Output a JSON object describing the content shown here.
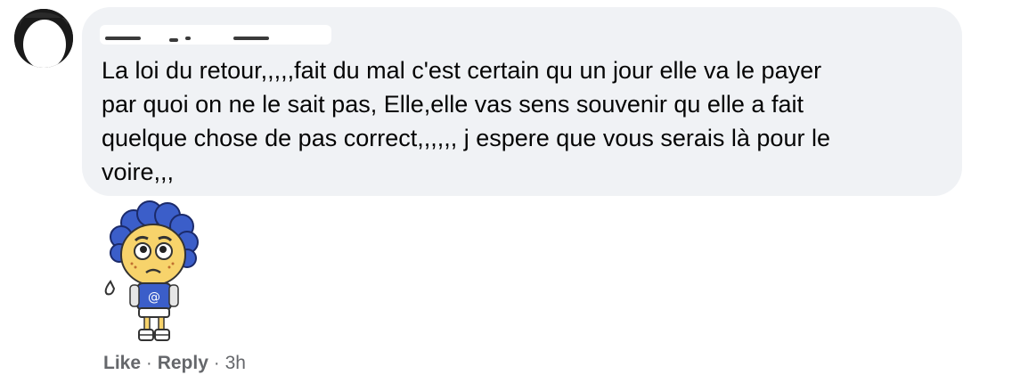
{
  "comment": {
    "text_lines": [
      "La loi du retour,,,,,fait du mal c'est certain qu un jour elle va le payer",
      "par quoi on ne le sait pas, Elle,elle vas sens souvenir qu elle a fait",
      "quelque chose de pas correct,,,,,, j espere que vous serais là pour le",
      "voire,,,"
    ],
    "sticker": "worried-boy-sticker-icon"
  },
  "actions": {
    "like_label": "Like",
    "reply_label": "Reply",
    "separator": "·",
    "timestamp": "3h"
  },
  "colors": {
    "bubble_bg": "#f0f2f5",
    "text": "#050505",
    "meta": "#65676b",
    "sticker_blue": "#3b5ec9"
  }
}
